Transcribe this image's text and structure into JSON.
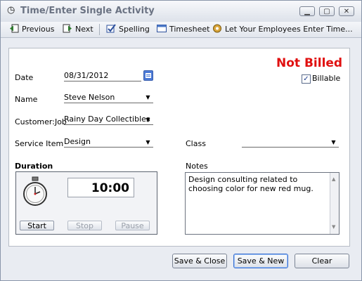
{
  "window": {
    "title": "Time/Enter Single Activity"
  },
  "toolbar": {
    "previous": "Previous",
    "next": "Next",
    "spelling": "Spelling",
    "timesheet": "Timesheet",
    "employees": "Let Your Employees Enter Time..."
  },
  "form": {
    "status": "Not Billed",
    "billable_label": "Billable",
    "billable_checked": true,
    "date_label": "Date",
    "date_value": "08/31/2012",
    "name_label": "Name",
    "name_value": "Steve Nelson",
    "customer_label": "Customer:Job",
    "customer_value": "Rainy Day Collectibles",
    "service_label": "Service Item",
    "service_value": "Design",
    "class_label": "Class",
    "class_value": "",
    "duration_label": "Duration",
    "duration_value": "10:00",
    "notes_label": "Notes",
    "notes_value": "Design consulting related to choosing color for new red mug."
  },
  "timer": {
    "start": "Start",
    "stop": "Stop",
    "pause": "Pause"
  },
  "footer": {
    "save_close": "Save & Close",
    "save_new": "Save & New",
    "clear": "Clear"
  }
}
